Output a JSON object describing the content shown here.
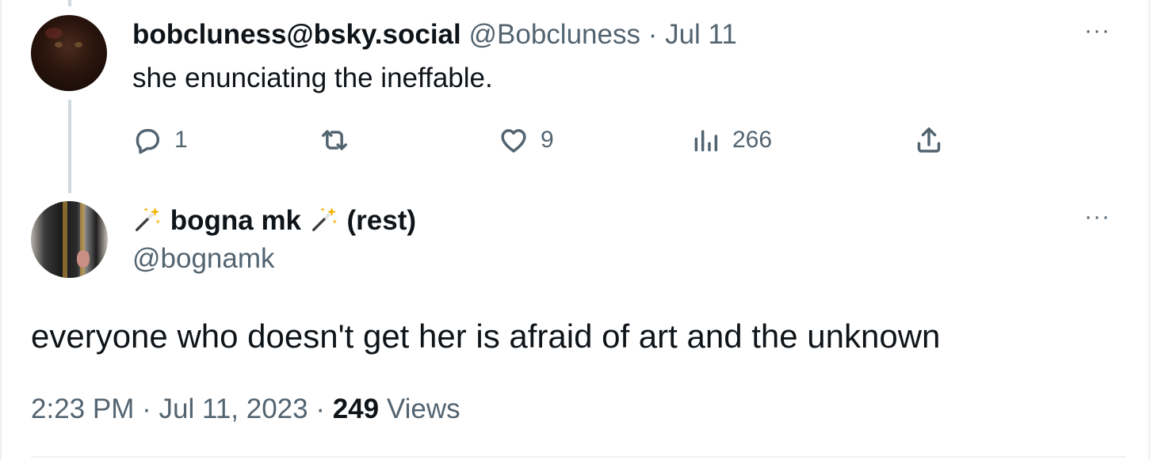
{
  "reply_tweet": {
    "display_name": "bobcluness@bsky.social",
    "handle": "@Bobcluness",
    "separator": "·",
    "date": "Jul 11",
    "text": "she enunciating the ineffable.",
    "counts": {
      "replies": "1",
      "likes": "9",
      "views": "266"
    },
    "more_label": "···"
  },
  "main_tweet": {
    "display_name_main": "bogna mk",
    "display_name_suffix": "(rest)",
    "handle": "@bognamk",
    "text": "everyone who doesn't get her is afraid of art and the unknown",
    "time": "2:23 PM",
    "separator": "·",
    "date": "Jul 11, 2023",
    "views_count": "249",
    "views_label": "Views",
    "more_label": "···"
  },
  "icons": [
    "reply-icon",
    "retweet-icon",
    "like-icon",
    "views-icon",
    "share-icon",
    "magic-wand-icon"
  ],
  "colors": {
    "text_primary": "#0f1419",
    "text_secondary": "#536471",
    "thread_line": "#cfd9de"
  }
}
